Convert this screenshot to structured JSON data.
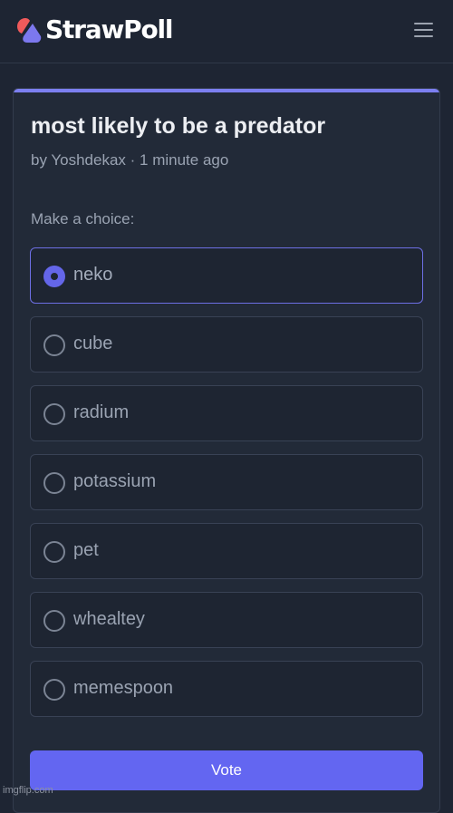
{
  "header": {
    "logo_text": "StrawPoll",
    "menu_icon": "hamburger-menu-icon",
    "logo_colors": {
      "red": "#f05a5b",
      "purple": "#7c78ee"
    }
  },
  "poll": {
    "title": "most likely to be a predator",
    "author_line": "by Yoshdekax · 1 minute ago",
    "prompt": "Make a choice:",
    "options": [
      {
        "label": "neko",
        "selected": true
      },
      {
        "label": "cube",
        "selected": false
      },
      {
        "label": "radium",
        "selected": false
      },
      {
        "label": "potassium",
        "selected": false
      },
      {
        "label": "pet",
        "selected": false
      },
      {
        "label": "whealtey",
        "selected": false
      },
      {
        "label": "memespoon",
        "selected": false
      }
    ],
    "vote_label": "Vote"
  },
  "watermark": "imgflip.com",
  "colors": {
    "background": "#1e2533",
    "card": "#222a38",
    "accent": "#6366f1",
    "selected_border": "#6d6fe4"
  }
}
